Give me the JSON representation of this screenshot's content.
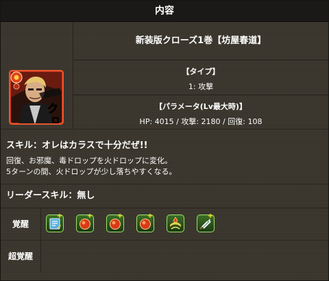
{
  "header": {
    "title": "内容"
  },
  "monster": {
    "name": "新装版クローズ1巻【坊屋春道】",
    "type_heading": "【タイプ】",
    "type_value": "1: 攻撃",
    "params_heading": "【パラメータ(Lv最大時)】",
    "params_value": "HP: 4015 / 攻撃: 2180 / 回復: 108",
    "portrait_icon": "character-portrait-icon",
    "portrait_attribute": "fire",
    "accent_color": "#d83a1f"
  },
  "skill": {
    "name": "スキル：オレはカラスで十分だぜ!!",
    "description_line1": "回復、お邪魔、毒ドロップを火ドロップに変化。",
    "description_line2": "5ターンの間、火ドロップが少し落ちやすくなる。"
  },
  "leader_skill": {
    "name": "リーダースキル：無し"
  },
  "awakenings": {
    "label": "覚醒",
    "icons": [
      "skill-boost-icon",
      "fire-orb-enhance-icon",
      "fire-orb-enhance-icon",
      "fire-orb-enhance-icon",
      "fire-row-icon",
      "two-pronged-attack-icon"
    ]
  },
  "super_awakenings": {
    "label": "超覚醒"
  }
}
